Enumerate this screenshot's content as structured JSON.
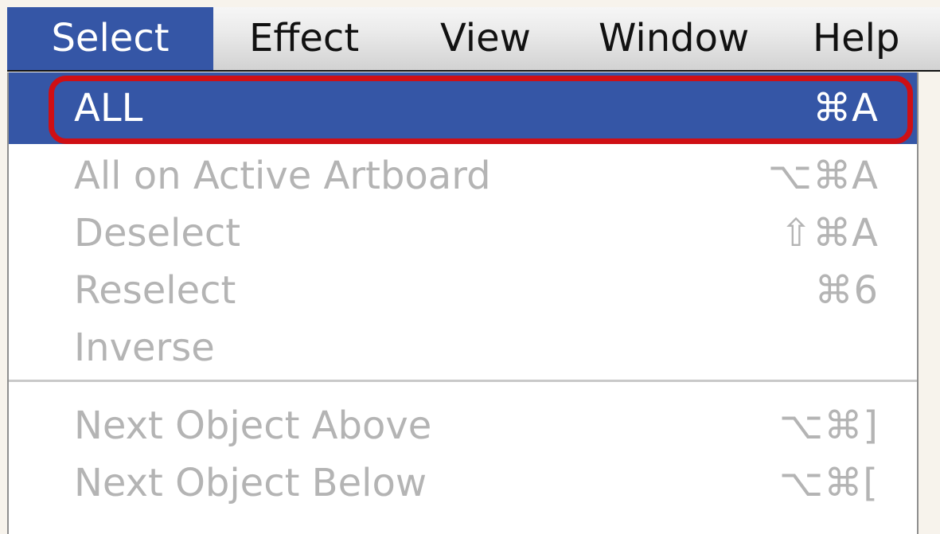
{
  "menubar": {
    "items": [
      {
        "label": "Select",
        "active": true
      },
      {
        "label": "Effect"
      },
      {
        "label": "View"
      },
      {
        "label": "Window"
      },
      {
        "label": "Help"
      }
    ]
  },
  "menu": {
    "items": [
      {
        "label": "ALL",
        "shortcut": "⌘A",
        "state": "highlighted"
      },
      {
        "label": "All on Active Artboard",
        "shortcut": "⌥⌘A",
        "state": "disabled"
      },
      {
        "label": "Deselect",
        "shortcut": "⇧⌘A",
        "state": "disabled"
      },
      {
        "label": "Reselect",
        "shortcut": "⌘6",
        "state": "disabled"
      },
      {
        "label": "Inverse",
        "shortcut": "",
        "state": "disabled"
      },
      {
        "label": "Next Object Above",
        "shortcut": "⌥⌘]",
        "state": "disabled"
      },
      {
        "label": "Next Object Below",
        "shortcut": "⌥⌘[",
        "state": "disabled"
      }
    ]
  },
  "colors": {
    "accent": "#3556a6",
    "disabled_text": "#b4b4b4",
    "annotation_ring": "#cf0f14"
  }
}
